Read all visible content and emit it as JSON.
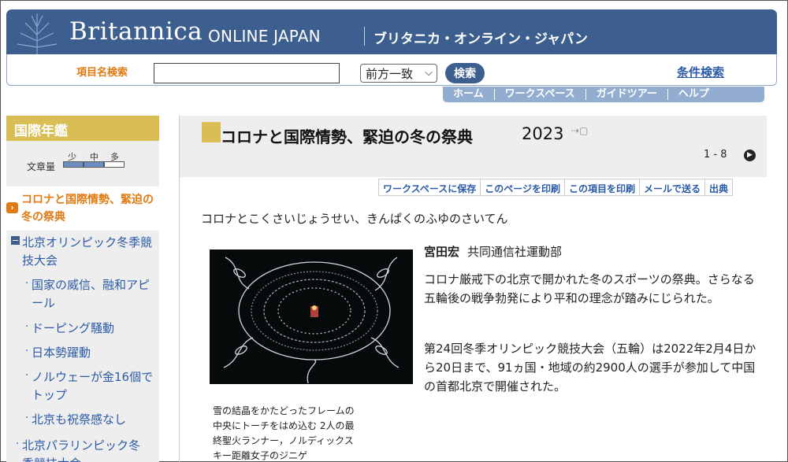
{
  "header": {
    "brand": "Britannica",
    "brand_sub": "ONLINE JAPAN",
    "brand_jp": "ブリタニカ・オンライン・ジャパン"
  },
  "search": {
    "label": "項目名検索",
    "input_value": "",
    "match_mode": "前方一致",
    "button_label": "検索",
    "advanced_label": "条件検索"
  },
  "nav": {
    "items": [
      "ホーム",
      "ワークスペース",
      "ガイドツアー",
      "ヘルプ"
    ]
  },
  "sidebar": {
    "title": "国際年鑑",
    "volume_label": "文章量",
    "volume_levels": [
      "少",
      "中",
      "多"
    ],
    "current_article": "コロナと国際情勢、緊迫の冬の祭典",
    "tree": {
      "head": "北京オリンピック冬季競技大会",
      "subs": [
        "国家の威信、融和アピール",
        "ドーピング騒動",
        "日本勢躍動",
        "ノルウェーが金16個でトップ",
        "北京も祝祭感なし"
      ],
      "next_head": "北京パラリンピック冬季競技大会"
    }
  },
  "article": {
    "title": "コロナと国際情勢、緊迫の冬の祭典",
    "year": "2023",
    "pager": "1 - 8",
    "tools": [
      "ワークスペースに保存",
      "このページを印刷",
      "この項目を印刷",
      "メールで送る",
      "出典"
    ],
    "reading": "コロナとこくさいじょうせい、きんぱくのふゆのさいてん",
    "author_name": "宮田宏",
    "author_org": "共同通信社運動部",
    "paragraphs": [
      "コロナ厳戒下の北京で開かれた冬のスポーツの祭典。さらなる五輪後の戦争勃発により平和の理念が踏みにじられた。",
      "第24回冬季オリンピック競技大会（五輪）は2022年2月4日から20日まで、91ヵ国・地域の約2900人の選手が参加して中国の首都北京で開催された。"
    ],
    "caption": "雪の結晶をかたどったフレームの中央にトーチをはめ込む 2人の最終聖火ランナー，ノルディックスキー距離女子のジニゲ"
  },
  "colors": {
    "brand_blue": "#3d5f8f",
    "accent_orange": "#e07a12",
    "gold": "#d9bd55",
    "link_blue": "#2b5aa6"
  }
}
